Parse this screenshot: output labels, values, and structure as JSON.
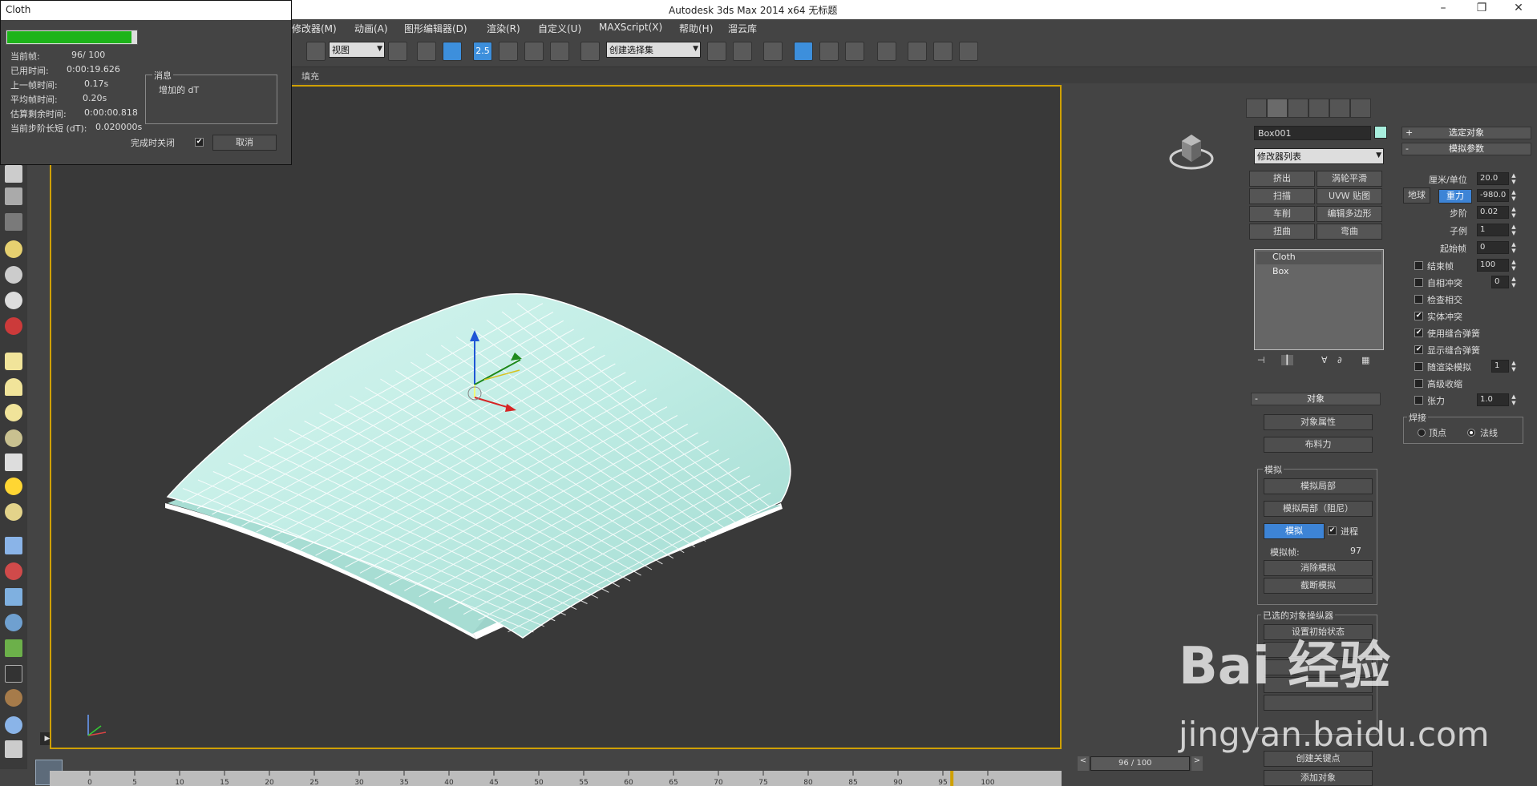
{
  "app": {
    "title": "Autodesk 3ds Max  2014 x64      无标题",
    "window_controls": [
      "–",
      "❐",
      "✕"
    ]
  },
  "menu": [
    "修改器(M)",
    "动画(A)",
    "图形编辑器(D)",
    "渲染(R)",
    "自定义(U)",
    "MAXScript(X)",
    "帮助(H)",
    "溜云库"
  ],
  "toolbar": {
    "view_combo": "视图",
    "selection_set_combo": "创建选择集",
    "snap_label": "2.5"
  },
  "subbar": {
    "fill_label": "填充"
  },
  "cloth_dialog": {
    "title": "Cloth",
    "progress": 0.96,
    "current_frame_label": "当前帧:",
    "current_frame_value": "96/  100",
    "elapsed_label": "已用时间:",
    "elapsed_value": "0:00:19.626",
    "last_frame_label": "上一帧时间:",
    "last_frame_value": "0.17s",
    "avg_frame_label": "平均帧时间:",
    "avg_frame_value": "0.20s",
    "remaining_label": "估算剩余时间:",
    "remaining_value": "0:00:00.818",
    "step_label": "当前步阶长短 (dT):",
    "step_value": "0.020000s",
    "message_caption": "消息",
    "message_text": "增加的 dT",
    "close_on_finish_label": "完成时关闭",
    "close_on_finish_checked": true,
    "cancel_label": "取消"
  },
  "modify_panel": {
    "object_name": "Box001",
    "object_color": "#a8eedd",
    "modifier_list_label": "修改器列表",
    "modifier_buttons": [
      "挤出",
      "涡轮平滑",
      "扫描",
      "UVW 贴图",
      "车削",
      "编辑多边形",
      "扭曲",
      "弯曲"
    ],
    "stack_items": [
      "Cloth",
      "Box"
    ],
    "object_rollout": "对象",
    "object_properties_label": "对象属性",
    "cloth_forces_label": "布料力",
    "simulation_group": "模拟",
    "simulate_local_label": "模拟局部",
    "simulate_local_damped_label": "模拟局部（阻尼）",
    "simulate_label": "模拟",
    "progress_label": "进程",
    "progress_checked": true,
    "sim_frame_label": "模拟帧:",
    "sim_frame_value": "97",
    "erase_sim_label": "消除模拟",
    "truncate_sim_label": "截断模拟",
    "selected_object_manipulators": "已选的对象操纵器",
    "set_initial_state_label": "设置初始状态",
    "create_keyframe_label": "创建关键点",
    "add_objects_label": "添加对象"
  },
  "params_panel": {
    "selected_object_rollout": "选定对象",
    "sim_params_rollout": "模拟参数",
    "cm_per_unit_label": "厘米/单位",
    "cm_per_unit_value": "20.0",
    "earth_label": "地球",
    "gravity_label": "重力",
    "gravity_value": "-980.0",
    "step_label": "步阶",
    "step_value": "0.02",
    "subsample_label": "子例",
    "subsample_value": "1",
    "start_frame_label": "起始帧",
    "start_frame_value": "0",
    "end_frame_label": "结束帧",
    "end_frame_value": "100",
    "self_collision_label": "自相冲突",
    "self_collision_value": "0",
    "check_intersection_label": "检查相交",
    "solid_collision_label": "实体冲突",
    "use_sewing_springs_label": "使用缝合弹簧",
    "show_sewing_springs_label": "显示缝合弹簧",
    "sim_on_render_label": "随渲染模拟",
    "sim_on_render_value": "1",
    "advanced_pinch_label": "高级收缩",
    "tension_label": "张力",
    "tension_value": "1.0",
    "weld_group": "焊接",
    "vertices_label": "顶点",
    "normals_label": "法线"
  },
  "timeline": {
    "frame_display": "96 / 100",
    "ticks": [
      "0",
      "5",
      "10",
      "15",
      "20",
      "25",
      "30",
      "35",
      "40",
      "45",
      "50",
      "55",
      "60",
      "65",
      "70",
      "75",
      "80",
      "85",
      "90",
      "95",
      "100"
    ]
  },
  "watermark": {
    "logo": "Bai 经验",
    "url": "jingyan.baidu.com"
  },
  "colors": {
    "accent": "#3d84d6",
    "cloth": "#bfece4",
    "highlight": "#cfa000"
  }
}
